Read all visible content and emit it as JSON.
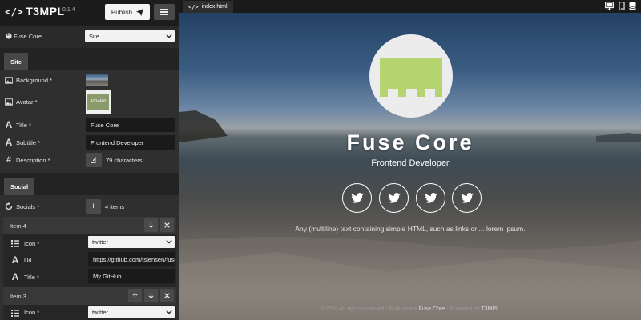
{
  "app": {
    "logo": "T3MPL",
    "version": "0.1.4"
  },
  "toolbar": {
    "publish_label": "Publish"
  },
  "template": {
    "label": "Fuse Core",
    "selected": "Site"
  },
  "tabs": {
    "site": "Site",
    "social": "Social"
  },
  "site_fields": {
    "background_label": "Background *",
    "avatar_label": "Avatar *",
    "avatar_placeholder": "400×400",
    "title_label": "Title *",
    "title_value": "Fuse Core",
    "subtitle_label": "Subtitle *",
    "subtitle_value": "Frontend Developer",
    "description_label": "Description *",
    "description_count": "79 characters"
  },
  "social": {
    "socials_label": "Socials *",
    "count": "4 items",
    "items": [
      {
        "header": "Item 4",
        "icon_label": "Icon *",
        "icon_value": "twitter",
        "url_label": "Url",
        "url_value": "https://github.com/tsjensen/fuse",
        "title_label": "Title *",
        "title_value": "My GitHub"
      },
      {
        "header": "Item 3",
        "icon_label": "Icon *",
        "icon_value": "twitter"
      }
    ]
  },
  "preview": {
    "file_tab": "index.html",
    "title": "Fuse Core",
    "subtitle": "Frontend Developer",
    "description": "Any (multiline) text containing simple HTML, such as links or ... lorem ipsum.",
    "footer_pre": "©2020 All rights reserved - Built on the ",
    "footer_link": "Fuse Core",
    "footer_post": " - Powered by ",
    "footer_link2": "T3MPL"
  },
  "colors": {
    "panel_bg": "#2a2a2a",
    "avatar_green": "#b5d36f",
    "input_bg": "#1a1a1a"
  }
}
